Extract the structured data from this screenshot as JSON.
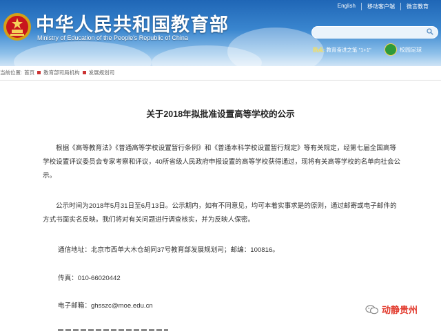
{
  "header": {
    "title_cn": "中华人民共和国教育部",
    "title_en": "Ministry of Education of the People's Republic of China",
    "top_links": [
      "English",
      "移动客户端",
      "微言教育"
    ],
    "search_placeholder": "",
    "hot_label": "热点:",
    "hot_text": "教育奋进之笔 \"1+1\"",
    "campus_label": "校园足球"
  },
  "breadcrumb": {
    "prefix": "当前位置:",
    "items": [
      "首页",
      "教育部司局机构",
      "发展规划司"
    ]
  },
  "article": {
    "title": "关于2018年拟批准设置高等学校的公示",
    "para1": "根据《高等教育法》《普通高等学校设置暂行条例》和《普通本科学校设置暂行规定》等有关规定，经第七届全国高等学校设置评议委员会专家考察和评议，40所省级人民政府申报设置的高等学校获得通过，现将有关高等学校的名单向社会公示。",
    "para2": "公示时间为2018年5月31日至6月13日。公示期内，如有不同意见，均可本着实事求是的原则，通过邮寄或电子邮件的方式书面实名反映。我们将对有关问题进行调查核实，并为反映人保密。",
    "address": "通信地址：北京市西单大木仓胡同37号教育部发展规划司；邮编：100816。",
    "fax": "传真：010-66020442",
    "email": "电子邮箱：ghsszc@moe.edu.cn"
  },
  "watermark": {
    "text": "动静贵州"
  },
  "colors": {
    "header_top": "#1f66b6",
    "header_bottom": "#cfe4f6",
    "accent_red": "#e23b2e",
    "breadcrumb_marker": "#cc3333"
  }
}
